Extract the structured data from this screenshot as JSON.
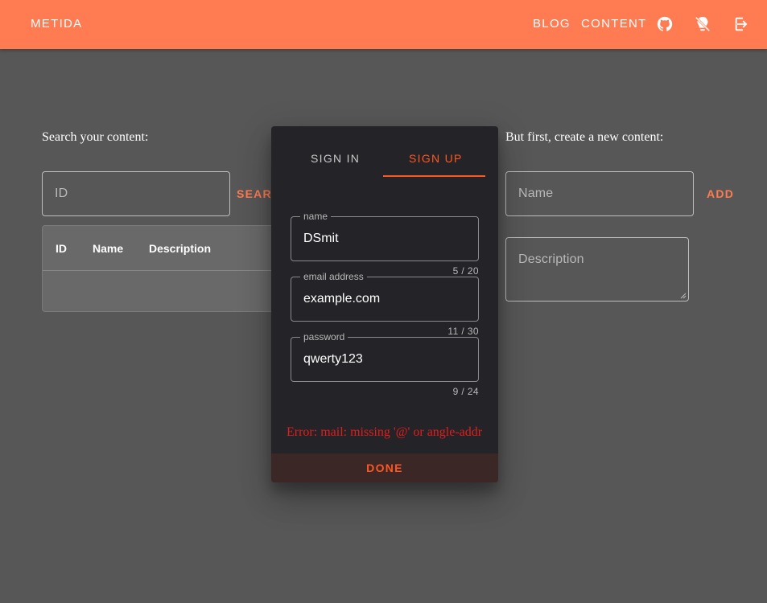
{
  "appbar": {
    "brand": "METIDA",
    "nav": {
      "blog": "BLOG",
      "content": "CONTENT"
    },
    "icons": [
      "github-icon",
      "lightbulb-off-icon",
      "login-icon"
    ],
    "color": "#ff7b52"
  },
  "search": {
    "label": "Search your content:",
    "id_placeholder": "ID",
    "button": "SEARCH",
    "table": {
      "columns": [
        "ID",
        "Name",
        "Description"
      ],
      "rows": []
    }
  },
  "create": {
    "label": "But first, create a new content:",
    "name_placeholder": "Name",
    "add_button": "ADD",
    "description_placeholder": "Description"
  },
  "dialog": {
    "tabs": {
      "signin": "SIGN IN",
      "signup": "SIGN UP",
      "active": "signup"
    },
    "fields": {
      "name": {
        "label": "name",
        "value": "DSmit",
        "counter": "5 / 20"
      },
      "email": {
        "label": "email address",
        "value": "example.com",
        "counter": "11 / 30"
      },
      "password": {
        "label": "password",
        "value": "qwerty123",
        "counter": "9 / 24"
      }
    },
    "error": "Error: mail: missing '@' or angle-addr",
    "done": "DONE",
    "accent": "#ff5722"
  }
}
